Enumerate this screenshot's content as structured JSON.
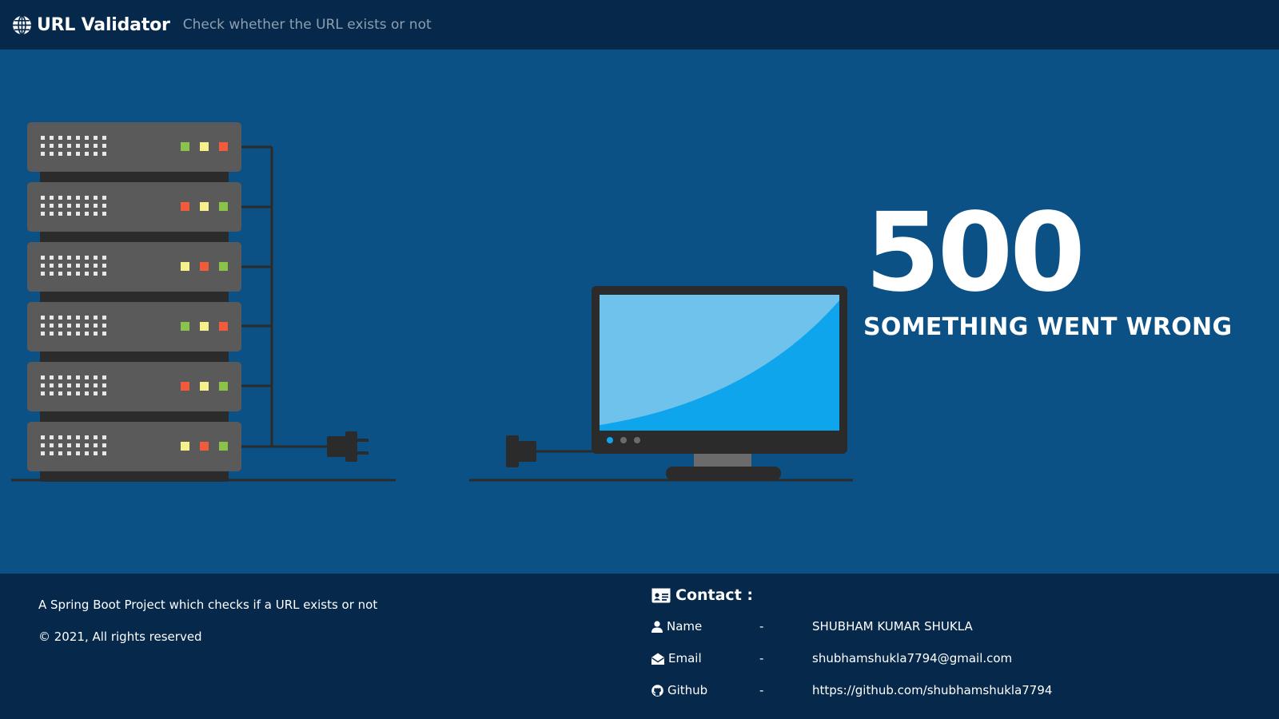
{
  "navbar": {
    "brand": "URL Validator",
    "tagline": "Check whether the URL exists or not"
  },
  "error": {
    "code": "500",
    "message": "SOMETHING WENT WRONG"
  },
  "footer": {
    "description": "A Spring Boot Project which checks if a URL exists or not",
    "copyright": "© 2021, All rights reserved",
    "contact": {
      "title": "Contact :",
      "separator": "-",
      "rows": [
        {
          "label": "Name",
          "value": "SHUBHAM KUMAR SHUKLA",
          "icon": "user-icon"
        },
        {
          "label": "Email",
          "value": "shubhamshukla7794@gmail.com",
          "icon": "envelope-open-icon"
        },
        {
          "label": "Github",
          "value": "https://github.com/shubhamshukla7794",
          "icon": "github-icon"
        }
      ]
    }
  },
  "colors": {
    "navbar_bg": "#06284a",
    "hero_bg": "#0b5186",
    "footer_bg": "#06284a",
    "server_body": "#5a5a5a",
    "screen_light": "#6ec2ec",
    "screen_dark": "#0ea5ec",
    "led_green": "#8bc34a",
    "led_yellow": "#f5f08c",
    "led_red": "#f15a3a"
  }
}
